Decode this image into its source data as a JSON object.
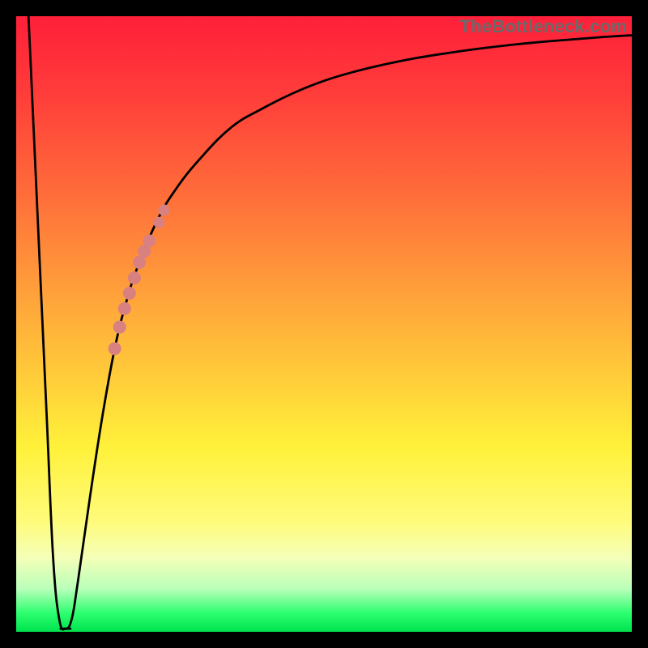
{
  "watermark": "TheBottleneck.com",
  "colors": {
    "frame": "#000000",
    "curve": "#000000",
    "highlight": "#d98080",
    "gradient_top": "#ff1f3a",
    "gradient_bottom": "#00e24e"
  },
  "chart_data": {
    "type": "line",
    "title": "",
    "xlabel": "",
    "ylabel": "",
    "xlim": [
      0,
      100
    ],
    "ylim": [
      0,
      100
    ],
    "grid": false,
    "legend": false,
    "series": [
      {
        "name": "bottleneck-curve",
        "x": [
          2,
          3,
          4,
          5,
          6,
          7,
          8,
          9,
          10,
          12,
          14,
          16,
          18,
          20,
          23,
          26,
          30,
          35,
          40,
          45,
          50,
          55,
          60,
          65,
          70,
          75,
          80,
          85,
          90,
          95,
          100
        ],
        "values": [
          100,
          78,
          56,
          34,
          12,
          2,
          0.5,
          2,
          8,
          22,
          35,
          46,
          54,
          60,
          67,
          72,
          77,
          82,
          85,
          87.5,
          89.5,
          91,
          92.2,
          93.2,
          94,
          94.7,
          95.3,
          95.8,
          96.2,
          96.6,
          96.9
        ]
      }
    ],
    "annotations": {
      "highlight_segment": {
        "description": "thicker salmon dots along curve segment",
        "x_range": [
          16,
          24
        ],
        "points": [
          {
            "x": 16.0,
            "y": 46.0
          },
          {
            "x": 16.8,
            "y": 49.5
          },
          {
            "x": 17.6,
            "y": 52.5
          },
          {
            "x": 18.4,
            "y": 55.0
          },
          {
            "x": 19.2,
            "y": 57.5
          },
          {
            "x": 20.0,
            "y": 60.0
          },
          {
            "x": 20.8,
            "y": 61.8
          },
          {
            "x": 21.6,
            "y": 63.5
          },
          {
            "x": 22.4,
            "y": 65.0
          },
          {
            "x": 23.2,
            "y": 66.5
          },
          {
            "x": 24.0,
            "y": 68.5
          }
        ],
        "gap_after_index": 8
      }
    }
  }
}
